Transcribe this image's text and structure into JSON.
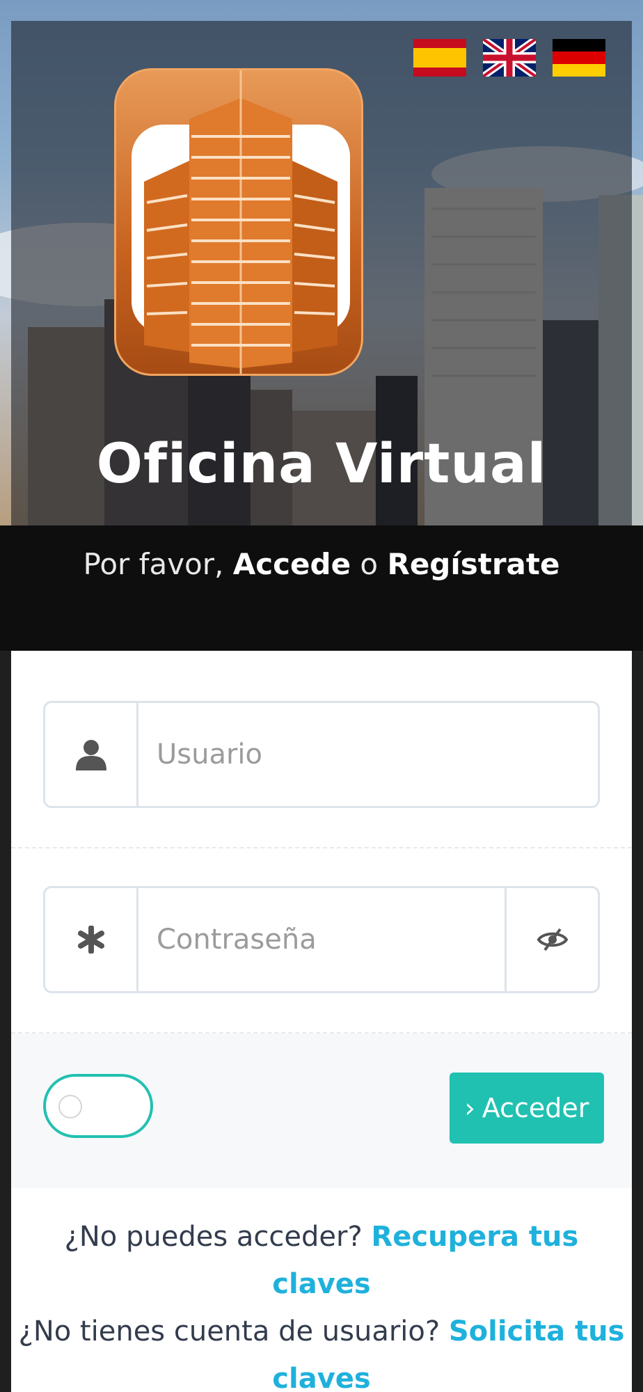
{
  "header": {
    "title": "Oficina Virtual",
    "languages": [
      {
        "name": "spain-flag-icon",
        "label": "Español"
      },
      {
        "name": "uk-flag-icon",
        "label": "English"
      },
      {
        "name": "germany-flag-icon",
        "label": "Deutsch"
      }
    ]
  },
  "band": {
    "prefix": "Por favor, ",
    "login_link": "Accede",
    "connector": " o ",
    "register_link": "Regístrate"
  },
  "form": {
    "username_placeholder": "Usuario",
    "password_placeholder": "Contraseña",
    "submit_label": "Acceder",
    "submit_icon": "chevron-right-icon",
    "remember_toggle_on": false
  },
  "links": {
    "recover_question": "¿No puedes acceder? ",
    "recover_link": "Recupera tus claves",
    "request_question": "¿No tienes cuenta de usuario? ",
    "request_link": "Solicita tus claves"
  },
  "colors": {
    "accent": "#21c1b1",
    "link": "#1fb1dc",
    "band": "#0e0e0e"
  }
}
